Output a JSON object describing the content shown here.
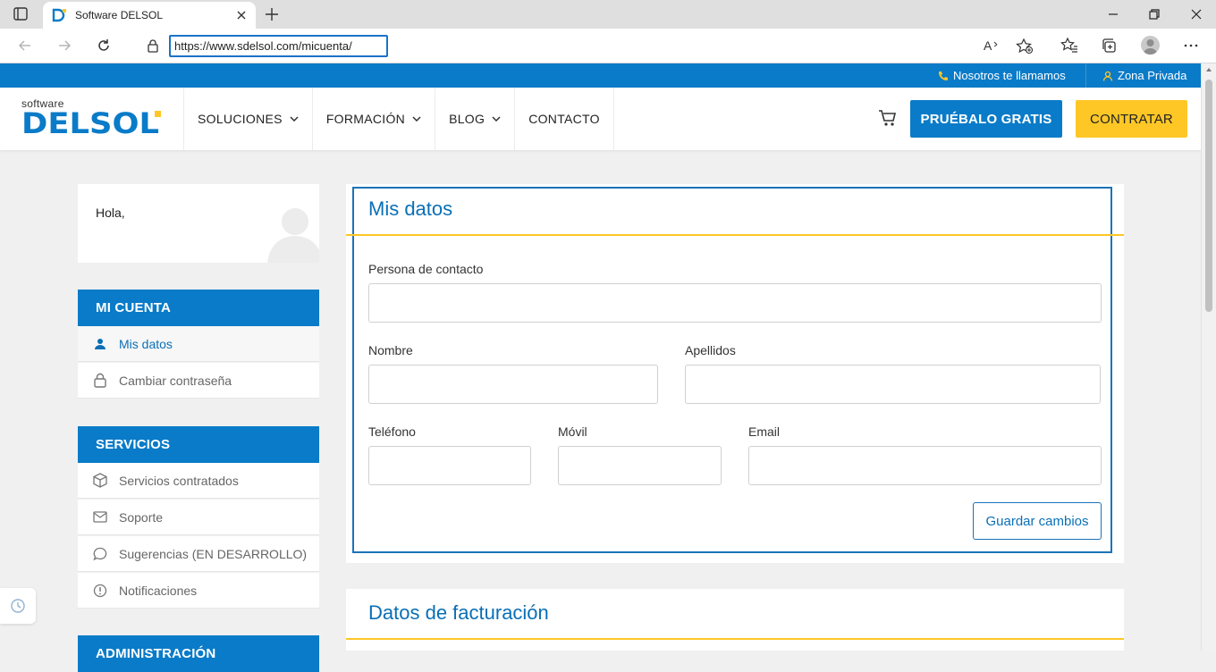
{
  "browser": {
    "tab_title": "Software DELSOL",
    "url": "https://www.sdelsol.com/micuenta/",
    "icons": [
      "tab-actions-icon",
      "close-icon",
      "plus-icon",
      "minimize-icon",
      "restore-icon",
      "window-close-icon",
      "back-icon",
      "forward-icon",
      "refresh-icon",
      "lock-icon",
      "read-aloud-icon",
      "add-favorite-icon",
      "favorites-icon",
      "collections-icon",
      "profile-icon",
      "more-icon"
    ]
  },
  "topbar": {
    "call_label": "Nosotros te llamamos",
    "private_label": "Zona Privada"
  },
  "header": {
    "logo_small": "software",
    "logo_big": "DELSOL",
    "nav": [
      "SOLUCIONES",
      "FORMACIÓN",
      "BLOG",
      "CONTACTO"
    ],
    "try_label": "PRUÉBALO GRATIS",
    "buy_label": "CONTRATAR"
  },
  "sidebar": {
    "greeting": "Hola,",
    "sections": [
      {
        "title": "MI CUENTA",
        "items": [
          {
            "label": "Mis datos",
            "icon": "user-icon",
            "active": true
          },
          {
            "label": "Cambiar contraseña",
            "icon": "lock-icon"
          }
        ]
      },
      {
        "title": "SERVICIOS",
        "items": [
          {
            "label": "Servicios contratados",
            "icon": "box-icon"
          },
          {
            "label": "Soporte",
            "icon": "mail-icon"
          },
          {
            "label": "Sugerencias (EN DESARROLLO)",
            "icon": "chat-icon"
          },
          {
            "label": "Notificaciones",
            "icon": "alert-icon"
          }
        ]
      },
      {
        "title": "ADMINISTRACIÓN"
      }
    ]
  },
  "form": {
    "title": "Mis datos",
    "contact_label": "Persona de contacto",
    "contact_value": "",
    "name_label": "Nombre",
    "name_value": "",
    "surname_label": "Apellidos",
    "surname_value": "",
    "phone_label": "Teléfono",
    "phone_value": "",
    "mobile_label": "Móvil",
    "mobile_value": "",
    "email_label": "Email",
    "email_value": "",
    "save_label": "Guardar cambios"
  },
  "billing": {
    "title": "Datos de facturación"
  },
  "colors": {
    "brand_blue": "#0a7bc8",
    "accent_yellow": "#fec726"
  }
}
